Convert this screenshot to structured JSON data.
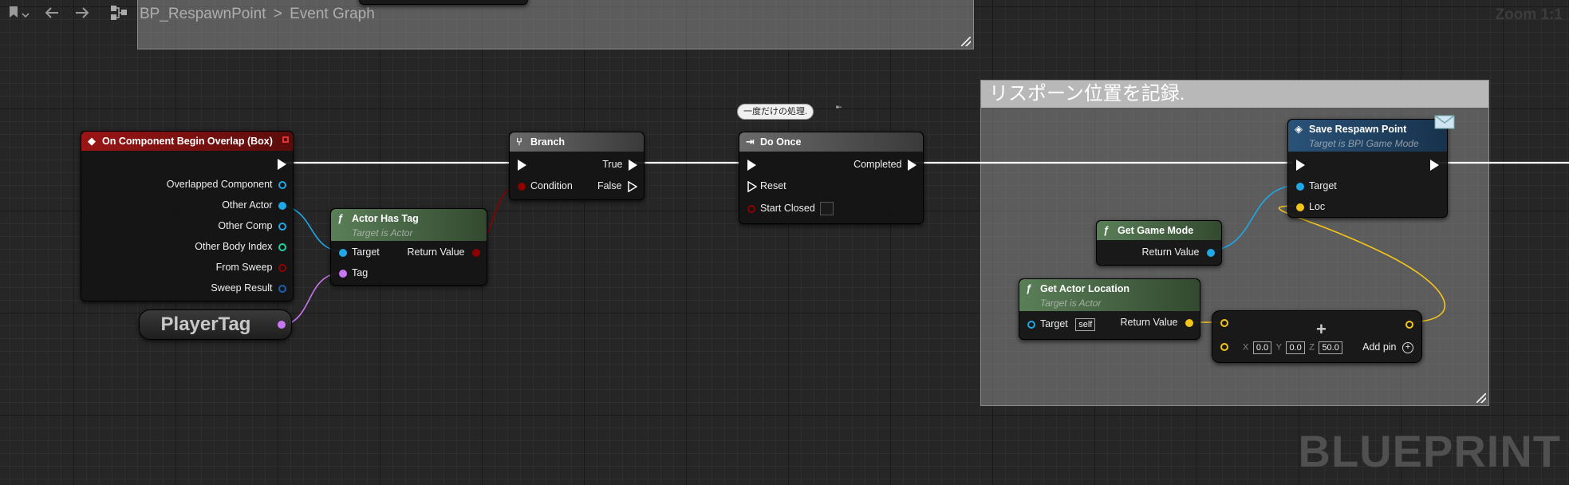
{
  "toolbar": {
    "breadcrumb_asset": "BP_RespawnPoint",
    "breadcrumb_separator": ">",
    "breadcrumb_graph": "Event Graph",
    "zoom": "Zoom 1:1",
    "icons": [
      "bookmark-icon",
      "chevron-down-icon",
      "back-arrow-icon",
      "forward-arrow-icon",
      "graph-hierarchy-icon"
    ]
  },
  "comments": {
    "respawn": {
      "title": "リスポーン位置を記録."
    }
  },
  "nodes": {
    "overlap_event": {
      "title": "On Component Begin Overlap (Box)",
      "pins": [
        "Overlapped Component",
        "Other Actor",
        "Other Comp",
        "Other Body Index",
        "From Sweep",
        "Sweep Result"
      ]
    },
    "player_tag": {
      "value": "PlayerTag"
    },
    "actor_has_tag": {
      "title": "Actor Has Tag",
      "subtitle": "Target is Actor",
      "pin_target": "Target",
      "pin_tag": "Tag",
      "pin_return": "Return Value"
    },
    "branch": {
      "title": "Branch",
      "pin_condition": "Condition",
      "pin_true": "True",
      "pin_false": "False"
    },
    "do_once": {
      "title": "Do Once",
      "comment_bubble": "一度だけの処理.",
      "pin_completed": "Completed",
      "pin_reset": "Reset",
      "pin_start_closed": "Start Closed"
    },
    "save_respawn": {
      "title": "Save Respawn Point",
      "subtitle": "Target is BPI Game Mode",
      "pin_target": "Target",
      "pin_loc": "Loc"
    },
    "get_game_mode": {
      "title": "Get Game Mode",
      "pin_return": "Return Value"
    },
    "get_actor_location": {
      "title": "Get Actor Location",
      "subtitle": "Target is Actor",
      "pin_target": "Target",
      "pin_target_default": "self",
      "pin_return": "Return Value"
    },
    "vector_add": {
      "x_label": "X",
      "x_value": "0.0",
      "y_label": "Y",
      "y_value": "0.0",
      "z_label": "Z",
      "z_value": "50.0",
      "add_pin": "Add pin",
      "operator": "+"
    }
  },
  "colors": {
    "exec": "#ffffff",
    "object": "#1fa7e6",
    "bool": "#8c0000",
    "name": "#c877f2",
    "vector": "#f5c518",
    "int": "#1dd3a0",
    "event_header": "#7a1010",
    "function_header": "#4a6a48",
    "flow_header": "#555555",
    "interface_header": "#1e3e5c"
  },
  "watermark": "BLUEPRINT"
}
